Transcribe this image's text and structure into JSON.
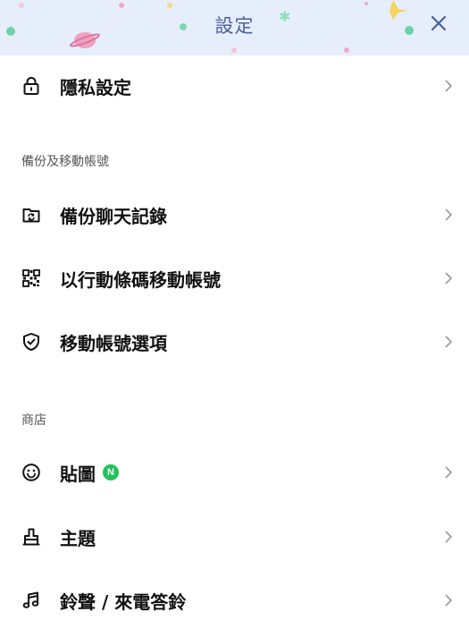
{
  "header": {
    "title": "設定",
    "close_icon": "close-icon",
    "background": "#e6eefc",
    "title_color": "#4a5fa0"
  },
  "items": {
    "privacy": {
      "label": "隱私設定",
      "icon": "lock-icon"
    },
    "backup_chat": {
      "label": "備份聊天記錄",
      "icon": "folder-sync-icon"
    },
    "migrate_qr": {
      "label": "以行動條碼移動帳號",
      "icon": "qr-code-icon"
    },
    "migrate_options": {
      "label": "移動帳號選項",
      "icon": "shield-check-icon"
    },
    "stickers": {
      "label": "貼圖",
      "icon": "smiley-icon",
      "badge": "N",
      "badge_color": "#21c35b"
    },
    "themes": {
      "label": "主題",
      "icon": "brush-icon"
    },
    "ringtones": {
      "label": "鈴聲 / 來電答鈴",
      "icon": "music-note-icon"
    }
  },
  "sections": {
    "backup": "備份及移動帳號",
    "shop": "商店"
  }
}
